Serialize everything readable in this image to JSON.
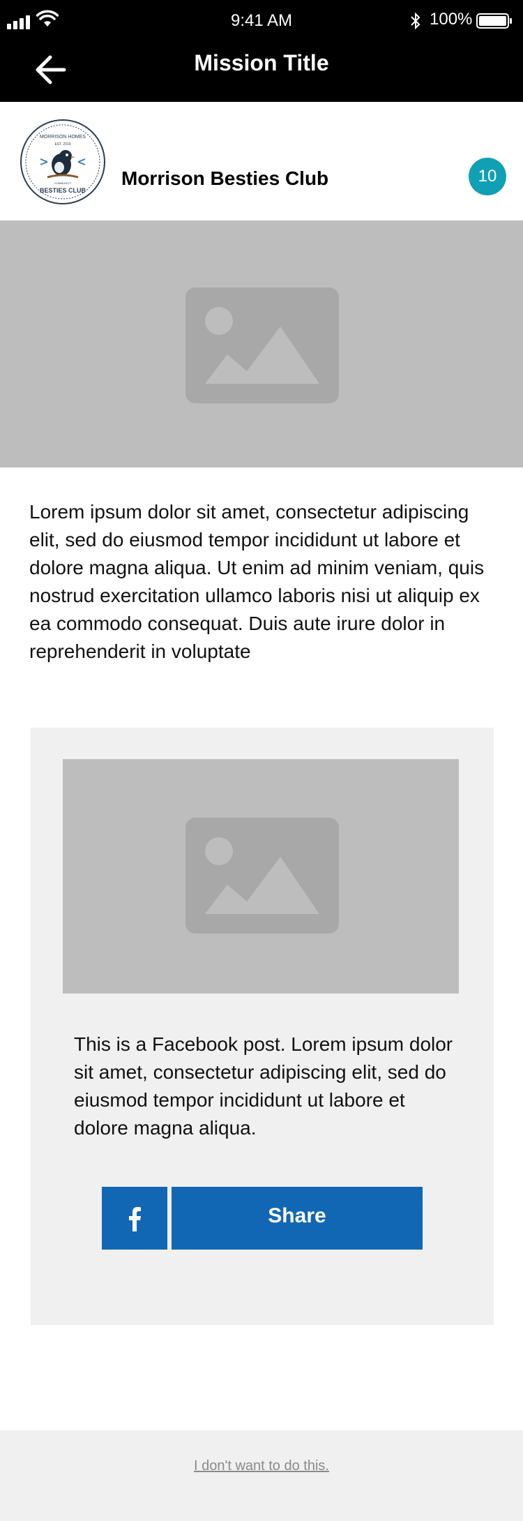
{
  "status_bar": {
    "time": "9:41 AM",
    "battery_percent": "100%",
    "icons": [
      "signal-icon",
      "wifi-icon",
      "bluetooth-icon",
      "battery-icon"
    ]
  },
  "nav": {
    "title": "Mission Title",
    "back_icon": "arrow-left-icon"
  },
  "club": {
    "name": "Morrison Besties Club",
    "badge_count": "10",
    "logo": {
      "top_text": "MORRISON HOMES",
      "est": "EST. 2019",
      "community": "COMMUNITY",
      "bottom_text": "BESTIES CLUB"
    }
  },
  "description": "Lorem ipsum dolor sit amet, consectetur adipiscing elit, sed do eiusmod tempor incididunt ut labore et dolore magna aliqua. Ut enim ad minim veniam, quis nostrud exercitation ullamco laboris nisi ut aliquip ex ea commodo consequat. Duis aute irure dolor in reprehenderit in voluptate",
  "post": {
    "text": "This is a Facebook post. Lorem ipsum dolor sit amet, consectetur adipiscing elit, sed do eiusmod tempor incididunt ut labore et dolore magna aliqua.",
    "share_label": "Share",
    "facebook_icon": "facebook-icon"
  },
  "footer": {
    "decline_label": "I don't want to do this."
  },
  "colors": {
    "accent_teal": "#10a0b5",
    "facebook_blue": "#1267b4",
    "placeholder_gray": "#bdbdbd",
    "card_bg": "#f1f0f1"
  }
}
